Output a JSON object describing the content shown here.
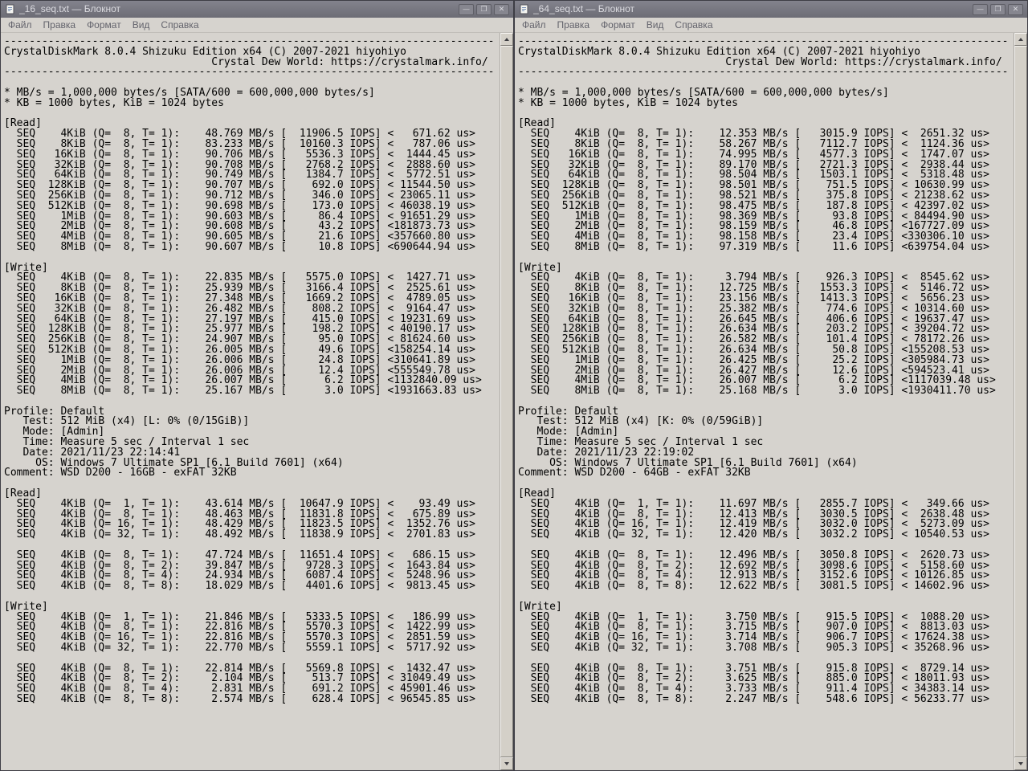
{
  "colors": {
    "titlebar": "#6c6c75",
    "titlebar_text": "#dbdbe0",
    "window_background": "#d6d3ce",
    "text": "#000000",
    "menu_text": "#63636c"
  },
  "windows": [
    {
      "title": "_16_seq.txt — Блокнот",
      "menu": [
        "Файл",
        "Правка",
        "Формат",
        "Вид",
        "Справка"
      ],
      "window_controls": {
        "minimize": "—",
        "maximize": "❐",
        "close": "✕"
      },
      "content_lines": [
        "------------------------------------------------------------------------------",
        "CrystalDiskMark 8.0.4 Shizuku Edition x64 (C) 2007-2021 hiyohiyo",
        "                                 Crystal Dew World: https://crystalmark.info/",
        "------------------------------------------------------------------------------",
        "",
        "* MB/s = 1,000,000 bytes/s [SATA/600 = 600,000,000 bytes/s]",
        "* KB = 1000 bytes, KiB = 1024 bytes",
        "",
        "[Read]",
        "  SEQ    4KiB (Q=  8, T= 1):    48.769 MB/s [  11906.5 IOPS] <   671.62 us>",
        "  SEQ    8KiB (Q=  8, T= 1):    83.233 MB/s [  10160.3 IOPS] <   787.06 us>",
        "  SEQ   16KiB (Q=  8, T= 1):    90.706 MB/s [   5536.3 IOPS] <  1444.45 us>",
        "  SEQ   32KiB (Q=  8, T= 1):    90.708 MB/s [   2768.2 IOPS] <  2888.60 us>",
        "  SEQ   64KiB (Q=  8, T= 1):    90.749 MB/s [   1384.7 IOPS] <  5772.51 us>",
        "  SEQ  128KiB (Q=  8, T= 1):    90.707 MB/s [    692.0 IOPS] < 11544.50 us>",
        "  SEQ  256KiB (Q=  8, T= 1):    90.712 MB/s [    346.0 IOPS] < 23065.11 us>",
        "  SEQ  512KiB (Q=  8, T= 1):    90.698 MB/s [    173.0 IOPS] < 46038.19 us>",
        "  SEQ    1MiB (Q=  8, T= 1):    90.603 MB/s [     86.4 IOPS] < 91651.29 us>",
        "  SEQ    2MiB (Q=  8, T= 1):    90.608 MB/s [     43.2 IOPS] <181873.73 us>",
        "  SEQ    4MiB (Q=  8, T= 1):    90.605 MB/s [     21.6 IOPS] <357660.80 us>",
        "  SEQ    8MiB (Q=  8, T= 1):    90.607 MB/s [     10.8 IOPS] <690644.94 us>",
        "",
        "[Write]",
        "  SEQ    4KiB (Q=  8, T= 1):    22.835 MB/s [   5575.0 IOPS] <  1427.71 us>",
        "  SEQ    8KiB (Q=  8, T= 1):    25.939 MB/s [   3166.4 IOPS] <  2525.61 us>",
        "  SEQ   16KiB (Q=  8, T= 1):    27.348 MB/s [   1669.2 IOPS] <  4789.05 us>",
        "  SEQ   32KiB (Q=  8, T= 1):    26.482 MB/s [    808.2 IOPS] <  9164.47 us>",
        "  SEQ   64KiB (Q=  8, T= 1):    27.197 MB/s [    415.0 IOPS] < 19231.69 us>",
        "  SEQ  128KiB (Q=  8, T= 1):    25.977 MB/s [    198.2 IOPS] < 40190.17 us>",
        "  SEQ  256KiB (Q=  8, T= 1):    24.907 MB/s [     95.0 IOPS] < 81624.60 us>",
        "  SEQ  512KiB (Q=  8, T= 1):    26.005 MB/s [     49.6 IOPS] <158254.14 us>",
        "  SEQ    1MiB (Q=  8, T= 1):    26.006 MB/s [     24.8 IOPS] <310641.89 us>",
        "  SEQ    2MiB (Q=  8, T= 1):    26.006 MB/s [     12.4 IOPS] <555549.78 us>",
        "  SEQ    4MiB (Q=  8, T= 1):    26.007 MB/s [      6.2 IOPS] <1132840.09 us>",
        "  SEQ    8MiB (Q=  8, T= 1):    25.167 MB/s [      3.0 IOPS] <1931663.83 us>",
        "",
        "Profile: Default",
        "   Test: 512 MiB (x4) [L: 0% (0/15GiB)]",
        "   Mode: [Admin]",
        "   Time: Measure 5 sec / Interval 1 sec",
        "   Date: 2021/11/23 22:14:41",
        "     OS: Windows 7 Ultimate SP1 [6.1 Build 7601] (x64)",
        "Comment: WSD D200 - 16GB - exFAT 32KB",
        "",
        "[Read]",
        "  SEQ    4KiB (Q=  1, T= 1):    43.614 MB/s [  10647.9 IOPS] <    93.49 us>",
        "  SEQ    4KiB (Q=  8, T= 1):    48.463 MB/s [  11831.8 IOPS] <   675.89 us>",
        "  SEQ    4KiB (Q= 16, T= 1):    48.429 MB/s [  11823.5 IOPS] <  1352.76 us>",
        "  SEQ    4KiB (Q= 32, T= 1):    48.492 MB/s [  11838.9 IOPS] <  2701.83 us>",
        "",
        "  SEQ    4KiB (Q=  8, T= 1):    47.724 MB/s [  11651.4 IOPS] <   686.15 us>",
        "  SEQ    4KiB (Q=  8, T= 2):    39.847 MB/s [   9728.3 IOPS] <  1643.84 us>",
        "  SEQ    4KiB (Q=  8, T= 4):    24.934 MB/s [   6087.4 IOPS] <  5248.96 us>",
        "  SEQ    4KiB (Q=  8, T= 8):    18.029 MB/s [   4401.6 IOPS] <  9813.45 us>",
        "",
        "[Write]",
        "  SEQ    4KiB (Q=  1, T= 1):    21.846 MB/s [   5333.5 IOPS] <   186.99 us>",
        "  SEQ    4KiB (Q=  8, T= 1):    22.816 MB/s [   5570.3 IOPS] <  1422.99 us>",
        "  SEQ    4KiB (Q= 16, T= 1):    22.816 MB/s [   5570.3 IOPS] <  2851.59 us>",
        "  SEQ    4KiB (Q= 32, T= 1):    22.770 MB/s [   5559.1 IOPS] <  5717.92 us>",
        "",
        "  SEQ    4KiB (Q=  8, T= 1):    22.814 MB/s [   5569.8 IOPS] <  1432.47 us>",
        "  SEQ    4KiB (Q=  8, T= 2):     2.104 MB/s [    513.7 IOPS] < 31049.49 us>",
        "  SEQ    4KiB (Q=  8, T= 4):     2.831 MB/s [    691.2 IOPS] < 45901.46 us>",
        "  SEQ    4KiB (Q=  8, T= 8):     2.574 MB/s [    628.4 IOPS] < 96545.85 us>"
      ]
    },
    {
      "title": "_64_seq.txt — Блокнот",
      "menu": [
        "Файл",
        "Правка",
        "Формат",
        "Вид",
        "Справка"
      ],
      "window_controls": {
        "minimize": "—",
        "maximize": "❐",
        "close": "✕"
      },
      "content_lines": [
        "------------------------------------------------------------------------------",
        "CrystalDiskMark 8.0.4 Shizuku Edition x64 (C) 2007-2021 hiyohiyo",
        "                                 Crystal Dew World: https://crystalmark.info/",
        "------------------------------------------------------------------------------",
        "",
        "* MB/s = 1,000,000 bytes/s [SATA/600 = 600,000,000 bytes/s]",
        "* KB = 1000 bytes, KiB = 1024 bytes",
        "",
        "[Read]",
        "  SEQ    4KiB (Q=  8, T= 1):    12.353 MB/s [   3015.9 IOPS] <  2651.32 us>",
        "  SEQ    8KiB (Q=  8, T= 1):    58.267 MB/s [   7112.7 IOPS] <  1124.36 us>",
        "  SEQ   16KiB (Q=  8, T= 1):    74.995 MB/s [   4577.3 IOPS] <  1747.07 us>",
        "  SEQ   32KiB (Q=  8, T= 1):    89.170 MB/s [   2721.3 IOPS] <  2938.44 us>",
        "  SEQ   64KiB (Q=  8, T= 1):    98.504 MB/s [   1503.1 IOPS] <  5318.48 us>",
        "  SEQ  128KiB (Q=  8, T= 1):    98.501 MB/s [    751.5 IOPS] < 10630.99 us>",
        "  SEQ  256KiB (Q=  8, T= 1):    98.521 MB/s [    375.8 IOPS] < 21238.62 us>",
        "  SEQ  512KiB (Q=  8, T= 1):    98.475 MB/s [    187.8 IOPS] < 42397.02 us>",
        "  SEQ    1MiB (Q=  8, T= 1):    98.369 MB/s [     93.8 IOPS] < 84494.90 us>",
        "  SEQ    2MiB (Q=  8, T= 1):    98.159 MB/s [     46.8 IOPS] <167727.09 us>",
        "  SEQ    4MiB (Q=  8, T= 1):    98.158 MB/s [     23.4 IOPS] <330306.10 us>",
        "  SEQ    8MiB (Q=  8, T= 1):    97.319 MB/s [     11.6 IOPS] <639754.04 us>",
        "",
        "[Write]",
        "  SEQ    4KiB (Q=  8, T= 1):     3.794 MB/s [    926.3 IOPS] <  8545.62 us>",
        "  SEQ    8KiB (Q=  8, T= 1):    12.725 MB/s [   1553.3 IOPS] <  5146.72 us>",
        "  SEQ   16KiB (Q=  8, T= 1):    23.156 MB/s [   1413.3 IOPS] <  5656.23 us>",
        "  SEQ   32KiB (Q=  8, T= 1):    25.382 MB/s [    774.6 IOPS] < 10314.60 us>",
        "  SEQ   64KiB (Q=  8, T= 1):    26.645 MB/s [    406.6 IOPS] < 19637.47 us>",
        "  SEQ  128KiB (Q=  8, T= 1):    26.634 MB/s [    203.2 IOPS] < 39204.72 us>",
        "  SEQ  256KiB (Q=  8, T= 1):    26.582 MB/s [    101.4 IOPS] < 78172.26 us>",
        "  SEQ  512KiB (Q=  8, T= 1):    26.634 MB/s [     50.8 IOPS] <155208.53 us>",
        "  SEQ    1MiB (Q=  8, T= 1):    26.425 MB/s [     25.2 IOPS] <305984.73 us>",
        "  SEQ    2MiB (Q=  8, T= 1):    26.427 MB/s [     12.6 IOPS] <594523.41 us>",
        "  SEQ    4MiB (Q=  8, T= 1):    26.007 MB/s [      6.2 IOPS] <1117039.48 us>",
        "  SEQ    8MiB (Q=  8, T= 1):    25.168 MB/s [      3.0 IOPS] <1930411.70 us>",
        "",
        "Profile: Default",
        "   Test: 512 MiB (x4) [K: 0% (0/59GiB)]",
        "   Mode: [Admin]",
        "   Time: Measure 5 sec / Interval 1 sec",
        "   Date: 2021/11/23 22:19:02",
        "     OS: Windows 7 Ultimate SP1 [6.1 Build 7601] (x64)",
        "Comment: WSD D200 - 64GB - exFAT 32KB",
        "",
        "[Read]",
        "  SEQ    4KiB (Q=  1, T= 1):    11.697 MB/s [   2855.7 IOPS] <   349.66 us>",
        "  SEQ    4KiB (Q=  8, T= 1):    12.413 MB/s [   3030.5 IOPS] <  2638.48 us>",
        "  SEQ    4KiB (Q= 16, T= 1):    12.419 MB/s [   3032.0 IOPS] <  5273.09 us>",
        "  SEQ    4KiB (Q= 32, T= 1):    12.420 MB/s [   3032.2 IOPS] < 10540.53 us>",
        "",
        "  SEQ    4KiB (Q=  8, T= 1):    12.496 MB/s [   3050.8 IOPS] <  2620.73 us>",
        "  SEQ    4KiB (Q=  8, T= 2):    12.692 MB/s [   3098.6 IOPS] <  5158.60 us>",
        "  SEQ    4KiB (Q=  8, T= 4):    12.913 MB/s [   3152.6 IOPS] < 10126.85 us>",
        "  SEQ    4KiB (Q=  8, T= 8):    12.622 MB/s [   3081.5 IOPS] < 14602.96 us>",
        "",
        "[Write]",
        "  SEQ    4KiB (Q=  1, T= 1):     3.750 MB/s [    915.5 IOPS] <  1088.20 us>",
        "  SEQ    4KiB (Q=  8, T= 1):     3.715 MB/s [    907.0 IOPS] <  8813.03 us>",
        "  SEQ    4KiB (Q= 16, T= 1):     3.714 MB/s [    906.7 IOPS] < 17624.38 us>",
        "  SEQ    4KiB (Q= 32, T= 1):     3.708 MB/s [    905.3 IOPS] < 35268.96 us>",
        "",
        "  SEQ    4KiB (Q=  8, T= 1):     3.751 MB/s [    915.8 IOPS] <  8729.14 us>",
        "  SEQ    4KiB (Q=  8, T= 2):     3.625 MB/s [    885.0 IOPS] < 18011.93 us>",
        "  SEQ    4KiB (Q=  8, T= 4):     3.733 MB/s [    911.4 IOPS] < 34383.14 us>",
        "  SEQ    4KiB (Q=  8, T= 8):     2.247 MB/s [    548.6 IOPS] < 56233.77 us>"
      ]
    }
  ]
}
